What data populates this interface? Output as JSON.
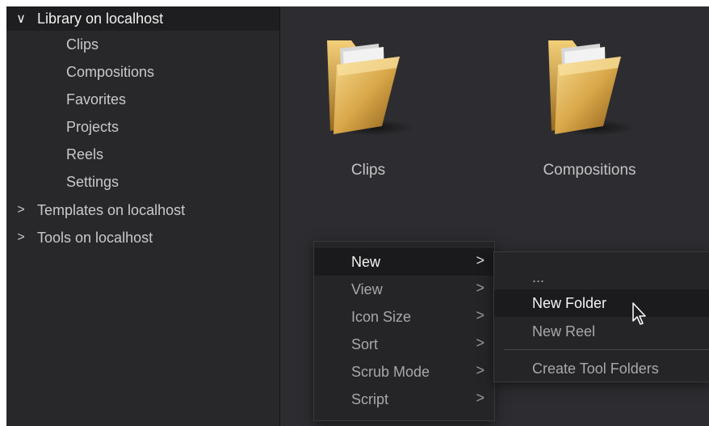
{
  "sidebar": {
    "root": {
      "label": "Library on localhost",
      "arrow": "∨"
    },
    "children": [
      "Clips",
      "Compositions",
      "Favorites",
      "Projects",
      "Reels",
      "Settings"
    ],
    "collapsed": [
      {
        "label": "Templates on localhost",
        "arrow": ">"
      },
      {
        "label": "Tools on localhost",
        "arrow": ">"
      }
    ]
  },
  "main": {
    "folders": [
      {
        "label": "Clips",
        "icon": "folder-icon"
      },
      {
        "label": "Compositions",
        "icon": "folder-icon"
      }
    ]
  },
  "context_menu": {
    "items": [
      {
        "label": "New",
        "chevron": ">"
      },
      {
        "label": "View",
        "chevron": ">"
      },
      {
        "label": "Icon Size",
        "chevron": ">"
      },
      {
        "label": "Sort",
        "chevron": ">"
      },
      {
        "label": "Scrub Mode",
        "chevron": ">"
      },
      {
        "label": "Script",
        "chevron": ">"
      }
    ],
    "active": "New"
  },
  "submenu": {
    "items": [
      "...",
      "New Folder",
      "New Reel",
      "Create Tool Folders"
    ],
    "hovered": "New Folder"
  },
  "colors": {
    "background": "#2d2d31",
    "sidebar": "#28282b",
    "folder_gold": "#d9a84a"
  }
}
